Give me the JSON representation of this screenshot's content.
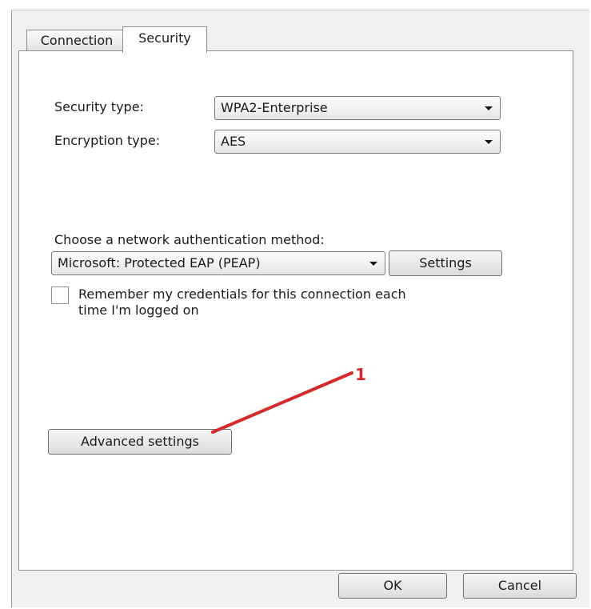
{
  "tabs": [
    {
      "label": "Connection"
    },
    {
      "label": "Security"
    }
  ],
  "security_type": {
    "label": "Security type:",
    "value": "WPA2-Enterprise"
  },
  "encryption_type": {
    "label": "Encryption type:",
    "value": "AES"
  },
  "auth_method": {
    "label": "Choose a network authentication method:",
    "value": "Microsoft: Protected EAP (PEAP)",
    "settings_label": "Settings"
  },
  "remember": {
    "line1": "Remember my credentials for this connection each",
    "line2": "time I'm logged on",
    "checked": false
  },
  "advanced_label": "Advanced settings",
  "annotation": {
    "number": "1",
    "color": "#d42a2a"
  },
  "footer": {
    "ok_label": "OK",
    "cancel_label": "Cancel"
  }
}
